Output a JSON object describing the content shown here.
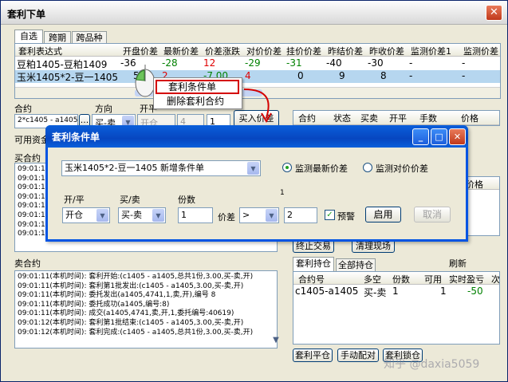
{
  "main": {
    "title": "套利下单",
    "close": "✕",
    "tabs": [
      "自选",
      "跨期",
      "跨品种"
    ],
    "grid": {
      "columns": [
        "套利表达式",
        "开盘价差",
        "最新价差",
        "价差涨跌",
        "对价价差",
        "挂价价差",
        "昨结价差",
        "昨收价差",
        "监测价差1",
        "监测价差"
      ],
      "rows": [
        [
          "豆粕1405-豆粕1409",
          "-36",
          "-28",
          "12",
          "-29",
          "-31",
          "-40",
          "-30",
          "-",
          "-"
        ],
        [
          "玉米1405*2-豆一1405",
          "5",
          "2",
          "-7.00",
          "4",
          "0",
          "9",
          "8",
          "-",
          "-"
        ]
      ]
    },
    "order": {
      "label_contract": "合约",
      "label_direction": "方向",
      "label_open": "开平",
      "contract_value": "2*c1405 - a1405",
      "browse": "...",
      "direction_value": "买-卖",
      "open_value": "开仓",
      "price_value": "4",
      "qty_value": "1",
      "submit": "买入价差"
    },
    "funds_label": "可用资金",
    "buy_section": "买合约",
    "sell_section": "卖合约",
    "buy_log": [
      "09:01:11",
      "09:01:11",
      "09:01:11",
      "09:01:11",
      "09:01:11",
      "09:01:11",
      "09:01:11",
      "09:01:11"
    ],
    "sell_log": [
      "09:01:11(本机时间): 套利开始:(c1405 - a1405,总共1份,3.00,买-卖,开)",
      "09:01:11(本机时间): 套利第1批发出:(c1405 - a1405,3.00,买-卖,开)",
      "09:01:11(本机时间): 委托发出(a1405,4741,1,卖,开),编号 8",
      "09:01:11(本机时间): 委托成功(a1405,编号:8)",
      "09:01:11(本机时间): 成交(a1405,4741,卖,开,1,委托编号:40619)",
      "09:01:12(本机时间): 套利第1批结束:(c1405 - a1405,3.00,买-卖,开)",
      "09:01:12(本机时间): 套利完成:(c1405 - a1405,总共1份,3.00,买-卖,开)"
    ],
    "orders_grid": {
      "columns": [
        "合约",
        "状态",
        "买卖",
        "开平",
        "手数",
        "价格"
      ]
    },
    "orders_grid2_header": "价格",
    "stop_trade": "终止交易",
    "clear_market": "清理现场",
    "position_tabs": [
      "套利持仓",
      "全部持仓"
    ],
    "refresh": "刷新",
    "positions": {
      "columns": [
        "合约号",
        "多空",
        "份数",
        "可用",
        "实时盈亏",
        "次"
      ],
      "rows": [
        [
          "c1405-a1405",
          "买-卖",
          "1",
          "1",
          "-50",
          ""
        ]
      ]
    },
    "bottom_buttons": [
      "套利平仓",
      "手动配对",
      "套利锁仓"
    ],
    "watermark": "知乎 @daxia5059"
  },
  "context_menu": {
    "items": [
      "套利条件单",
      "删除套利合约"
    ]
  },
  "dialog": {
    "title": "套利条件单",
    "btn_min": "_",
    "btn_max": "□",
    "btn_close": "✕",
    "expr_value": "玉米1405*2-豆一1405  新增条件单",
    "radio_latest": "监测最新价差",
    "radio_counter": "监测对价价差",
    "label_open": "开/平",
    "label_direction": "买/卖",
    "label_qty": "份数",
    "label_spread": "价差",
    "open_value": "开仓",
    "direction_value": "买-卖",
    "qty_value": "1",
    "op_value": ">",
    "spread_value": "2",
    "number_label": "1",
    "alert_label": "预警",
    "alert_checked": "✓",
    "enable": "启用",
    "cancel": "取消"
  },
  "colors": {
    "accent": "#0054e3",
    "title_bar": "#0a5fdb",
    "up": "#e00000",
    "down": "#008000",
    "selected_row": "#b6d6ef"
  },
  "icons": {
    "mouse": "mouse-cursor-icon",
    "arrow": "callout-arrow-icon"
  }
}
